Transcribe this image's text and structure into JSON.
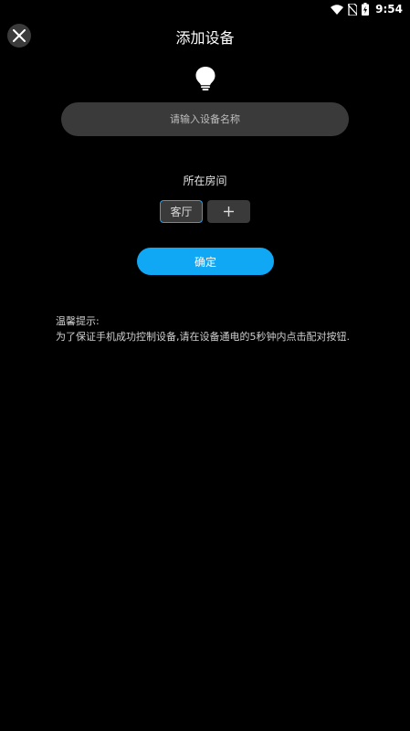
{
  "status_bar": {
    "time": "9:54",
    "icons": [
      "wifi-icon",
      "no-sim-icon",
      "battery-charging-icon"
    ]
  },
  "header": {
    "title": "添加设备",
    "close_icon": "close-icon"
  },
  "device": {
    "icon": "lightbulb-icon",
    "name_placeholder": "请输入设备名称",
    "name_value": ""
  },
  "room": {
    "label": "所在房间",
    "selected": "客厅",
    "add_icon": "plus-icon"
  },
  "actions": {
    "confirm_label": "确定"
  },
  "tips": {
    "title": "温馨提示:",
    "body": "为了保证手机成功控制设备,请在设备通电的5秒钟内点击配对按钮."
  },
  "colors": {
    "background": "#000000",
    "accent": "#10a8f5",
    "input_bg": "#3a3a3a",
    "chip_border": "#2f9de0"
  }
}
